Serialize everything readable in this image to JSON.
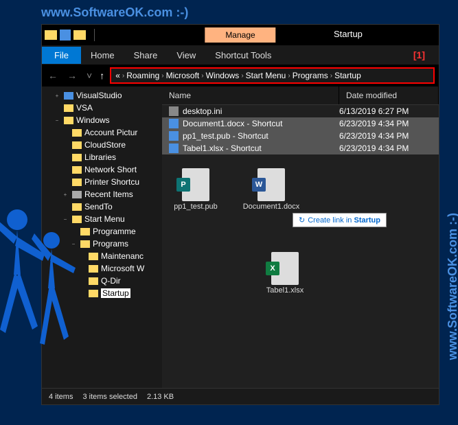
{
  "watermark": "www.SoftwareOK.com :-)",
  "titlebar": {
    "manage": "Manage",
    "title": "Startup"
  },
  "ribbon": {
    "file": "File",
    "tabs": [
      "Home",
      "Share",
      "View",
      "Shortcut Tools"
    ],
    "marker": "[1]"
  },
  "breadcrumb": {
    "prefix": "«",
    "items": [
      "Roaming",
      "Microsoft",
      "Windows",
      "Start Menu",
      "Programs",
      "Startup"
    ]
  },
  "sidebar": {
    "items": [
      {
        "label": "VisualStudio",
        "indent": 1,
        "exp": "+",
        "type": "blue"
      },
      {
        "label": "VSA",
        "indent": 1,
        "exp": "",
        "type": "folder"
      },
      {
        "label": "Windows",
        "indent": 1,
        "exp": "−",
        "type": "folder"
      },
      {
        "label": "Account Pictur",
        "indent": 2,
        "exp": "",
        "type": "folder"
      },
      {
        "label": "CloudStore",
        "indent": 2,
        "exp": "",
        "type": "folder"
      },
      {
        "label": "Libraries",
        "indent": 2,
        "exp": "",
        "type": "folder"
      },
      {
        "label": "Network Short",
        "indent": 2,
        "exp": "",
        "type": "folder"
      },
      {
        "label": "Printer Shortcu",
        "indent": 2,
        "exp": "",
        "type": "folder"
      },
      {
        "label": "Recent Items",
        "indent": 2,
        "exp": "+",
        "type": "sys"
      },
      {
        "label": "SendTo",
        "indent": 2,
        "exp": "",
        "type": "folder"
      },
      {
        "label": "Start Menu",
        "indent": 2,
        "exp": "−",
        "type": "folder"
      },
      {
        "label": "Programme",
        "indent": 3,
        "exp": "",
        "type": "folder"
      },
      {
        "label": "Programs",
        "indent": 3,
        "exp": "−",
        "type": "folder"
      },
      {
        "label": "Maintenanc",
        "indent": 4,
        "exp": "",
        "type": "folder"
      },
      {
        "label": "Microsoft W",
        "indent": 4,
        "exp": "",
        "type": "folder"
      },
      {
        "label": "Q-Dir",
        "indent": 4,
        "exp": "",
        "type": "folder"
      },
      {
        "label": "Startup",
        "indent": 4,
        "exp": "",
        "type": "folder",
        "selected": true
      }
    ]
  },
  "list": {
    "cols": {
      "name": "Name",
      "date": "Date modified"
    },
    "rows": [
      {
        "name": "desktop.ini",
        "date": "6/13/2019 6:27 PM",
        "sel": false,
        "icon": "sys"
      },
      {
        "name": "Document1.docx - Shortcut",
        "date": "6/23/2019 4:34 PM",
        "sel": true,
        "icon": "doc"
      },
      {
        "name": "pp1_test.pub - Shortcut",
        "date": "6/23/2019 4:34 PM",
        "sel": true,
        "icon": "doc"
      },
      {
        "name": "Tabel1.xlsx - Shortcut",
        "date": "6/23/2019 4:34 PM",
        "sel": true,
        "icon": "doc"
      }
    ]
  },
  "drag": {
    "items": [
      {
        "label": "pp1_test.pub",
        "badge": "P",
        "cls": "p"
      },
      {
        "label": "Document1.docx",
        "badge": "W",
        "cls": "w"
      },
      {
        "label": "Tabel1.xlsx",
        "badge": "X",
        "cls": "x"
      }
    ]
  },
  "tooltip": {
    "pre": "Create link in ",
    "bold": "Startup"
  },
  "statusbar": {
    "items": "4 items",
    "selected": "3 items selected",
    "size": "2.13 KB"
  }
}
